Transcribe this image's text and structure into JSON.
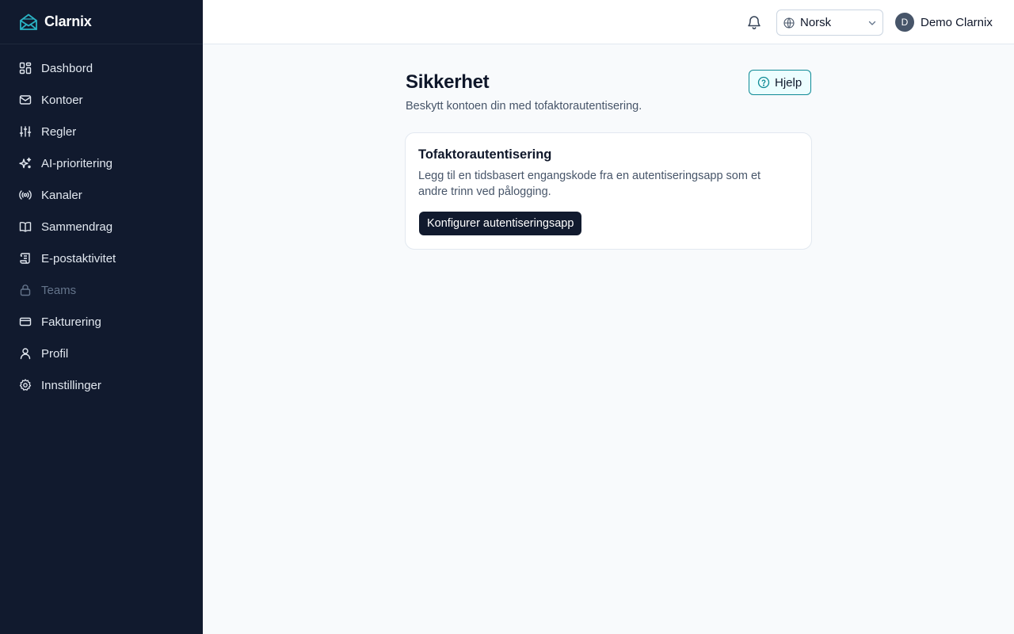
{
  "brand": {
    "name": "Clarnix",
    "color": "#2ab3c4"
  },
  "sidebar": {
    "items": [
      {
        "label": "Dashbord",
        "icon": "dashboard-icon"
      },
      {
        "label": "Kontoer",
        "icon": "mail-icon"
      },
      {
        "label": "Regler",
        "icon": "sliders-icon"
      },
      {
        "label": "AI-prioritering",
        "icon": "sparkles-icon"
      },
      {
        "label": "Kanaler",
        "icon": "radio-icon"
      },
      {
        "label": "Sammendrag",
        "icon": "book-icon"
      },
      {
        "label": "E-postaktivitet",
        "icon": "scroll-icon"
      },
      {
        "label": "Teams",
        "icon": "lock-icon",
        "disabled": true
      },
      {
        "label": "Fakturering",
        "icon": "credit-card-icon"
      },
      {
        "label": "Profil",
        "icon": "user-icon"
      },
      {
        "label": "Innstillinger",
        "icon": "gear-icon"
      }
    ]
  },
  "header": {
    "language": "Norsk",
    "user": {
      "initial": "D",
      "name": "Demo Clarnix"
    }
  },
  "page": {
    "title": "Sikkerhet",
    "subtitle": "Beskytt kontoen din med tofaktorautentisering.",
    "help_label": "Hjelp"
  },
  "card": {
    "title": "Tofaktorautentisering",
    "description": "Legg til en tidsbasert engangskode fra en autentiseringsapp som et andre trinn ved pålogging.",
    "button_label": "Konfigurer autentiseringsapp"
  },
  "colors": {
    "sidebar_bg": "#111a2e",
    "accent": "#0e8a95",
    "background": "#f8fafc"
  }
}
